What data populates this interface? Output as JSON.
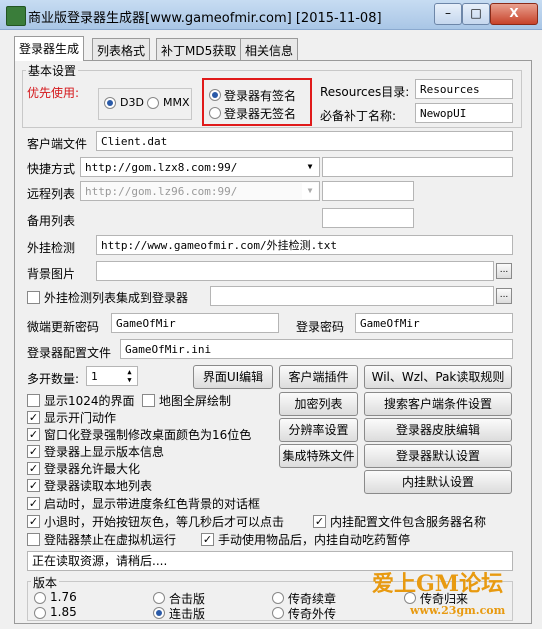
{
  "window": {
    "title": "商业版登录器生成器[www.gameofmir.com] [2015-11-08]",
    "minimize": "–",
    "maximize": "□",
    "close": "X"
  },
  "tabs": [
    "登录器生成",
    "列表格式",
    "补丁MD5获取",
    "相关信息"
  ],
  "basic": {
    "group_label": "基本设置",
    "priority_label": "优先使用:",
    "d3d": "D3D",
    "mmx": "MMX",
    "signed": "登录器有签名",
    "unsigned": "登录器无签名",
    "resources_label": "Resources目录:",
    "resources_value": "Resources",
    "patch_label": "必备补丁名称:",
    "patch_value": "NewopUI"
  },
  "client_file": {
    "label": "客户端文件",
    "value": "Client.dat"
  },
  "shortcut": {
    "label": "快捷方式",
    "value": "http://gom.lzx8.com:99/"
  },
  "remote_list": {
    "label": "远程列表",
    "value": "http://gom.lz96.com:99/"
  },
  "backup_list": {
    "label": "备用列表"
  },
  "cheat_detect": {
    "label": "外挂检测",
    "value": "http://www.gameofmir.com/外挂检测.txt"
  },
  "bg_image": {
    "label": "背景图片"
  },
  "integrate": {
    "label": "外挂检测列表集成到登录器"
  },
  "micro_pwd": {
    "label": "微端更新密码",
    "value": "GameOfMir"
  },
  "login_pwd": {
    "label": "登录密码",
    "value": "GameOfMir"
  },
  "config_file": {
    "label": "登录器配置文件",
    "value": "GameOfMir.ini"
  },
  "multi": {
    "label": "多开数量:",
    "value": "1"
  },
  "buttons": {
    "ui_edit": "界面UI编辑",
    "client_plugin": "客户端插件",
    "wil_rule": "Wil、Wzl、Pak读取规则",
    "encrypt_list": "加密列表",
    "search_client": "搜索客户端条件设置",
    "resolution": "分辨率设置",
    "skin_edit": "登录器皮肤编辑",
    "special_file": "集成特殊文件",
    "default_login": "登录器默认设置",
    "default_plugin": "内挂默认设置"
  },
  "checks": {
    "c1024": "显示1024的界面",
    "mapfull": "地图全屏绘制",
    "open_anim": "显示开门动作",
    "win16": "窗口化登录强制修改桌面颜色为16位色",
    "show_ver": "登录器上显示版本信息",
    "maximize": "登录器允许最大化",
    "local_list": "登录器读取本地列表",
    "progress_dlg": "启动时，显示带进度条红色背景的对话框",
    "gray_btn": "小退时，开始按钮灰色，等几秒后才可以点击",
    "server_name": "内挂配置文件包含服务器名称",
    "no_vm": "登陆器禁止在虚拟机运行",
    "manual_item": "手动使用物品后，内挂自动吃药暂停"
  },
  "status": "正在读取资源，请稍后....",
  "version": {
    "label": "版本",
    "v176": "1.76",
    "v185": "1.85",
    "heji": "合击版",
    "liandi": "连击版",
    "chuanqi_xu": "传奇续章",
    "chuanqi_wai": "传奇外传",
    "chuanqi_gui": "传奇归来",
    "watermark": "爱上GM论坛",
    "watermark_url": "www.23gm.com"
  }
}
